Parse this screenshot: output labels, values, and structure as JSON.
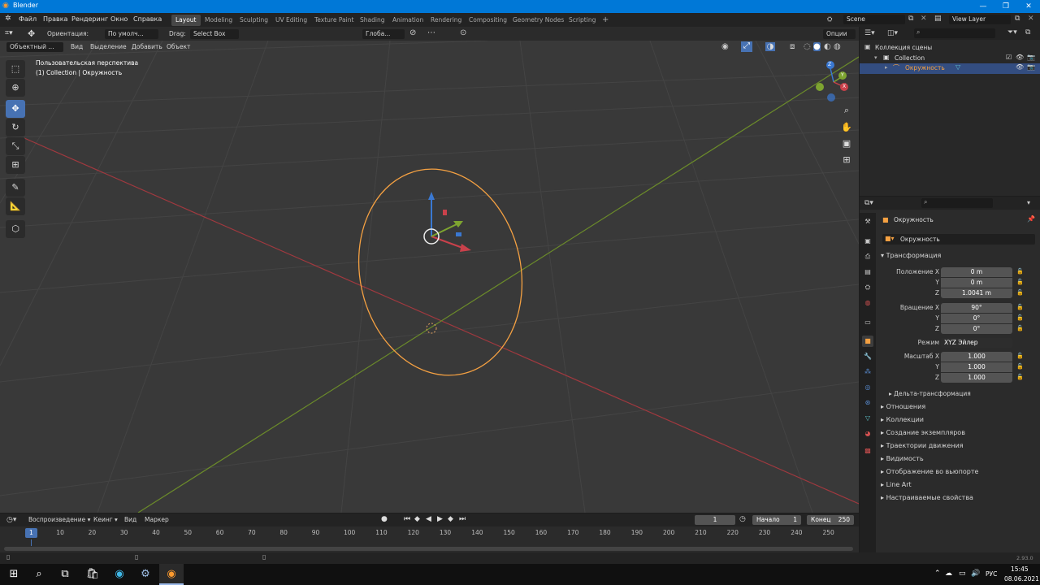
{
  "window": {
    "title": "Blender",
    "minimize": "—",
    "maximize": "❐",
    "close": "✕"
  },
  "menubar": {
    "items": [
      "Файл",
      "Правка",
      "Рендеринг",
      "Окно",
      "Справка"
    ],
    "workspaces": [
      "Layout",
      "Modeling",
      "Sculpting",
      "UV Editing",
      "Texture Paint",
      "Shading",
      "Animation",
      "Rendering",
      "Compositing",
      "Geometry Nodes",
      "Scripting"
    ],
    "active_workspace": "Layout",
    "add_tab": "+",
    "scene": "Scene",
    "view_layer": "View Layer"
  },
  "viewport_header": {
    "orientation_label": "Ориентация:",
    "orientation_value": "По умолч...",
    "drag_label": "Drag:",
    "drag_value": "Select Box",
    "pivot_value": "Глоба...",
    "options": "Опции",
    "mode": "Объектный ...",
    "menus": [
      "Вид",
      "Выделение",
      "Добавить",
      "Объект"
    ]
  },
  "viewport": {
    "view_name": "Пользовательская перспектива",
    "collection_info": "(1) Collection | Окружность",
    "gizmo_axes": [
      "Z",
      "Y",
      "X"
    ]
  },
  "outliner": {
    "scene_collection": "Коллекция сцены",
    "collection": "Collection",
    "object": "Окружность"
  },
  "properties": {
    "object_name": "Окружность",
    "data_name": "Окружность",
    "transform_title": "Трансформация",
    "location": {
      "label_x": "Положение X",
      "label_y": "Y",
      "label_z": "Z",
      "x": "0 m",
      "y": "0 m",
      "z": "1.0041 m"
    },
    "rotation": {
      "label_x": "Вращение X",
      "label_y": "Y",
      "label_z": "Z",
      "x": "90°",
      "y": "0°",
      "z": "0°"
    },
    "mode": {
      "label": "Режим",
      "value": "XYZ Эйлер"
    },
    "scale": {
      "label_x": "Масштаб X",
      "label_y": "Y",
      "label_z": "Z",
      "x": "1.000",
      "y": "1.000",
      "z": "1.000"
    },
    "delta": "Дельта-трансформация",
    "sections": [
      "Отношения",
      "Коллекции",
      "Создание экземпляров",
      "Траектории движения",
      "Видимость",
      "Отображение во вьюпорте",
      "Line Art",
      "Настраиваемые свойства"
    ]
  },
  "timeline": {
    "playback": "Воспроизведение",
    "keying": "Кеинг",
    "view": "Вид",
    "marker": "Маркер",
    "current_frame": "1",
    "start_label": "Начало",
    "start": "1",
    "end_label": "Конец",
    "end": "250",
    "ticks": [
      "1",
      "10",
      "20",
      "30",
      "40",
      "50",
      "60",
      "70",
      "80",
      "90",
      "100",
      "110",
      "120",
      "130",
      "140",
      "150",
      "160",
      "170",
      "180",
      "190",
      "200",
      "210",
      "220",
      "230",
      "240",
      "250"
    ]
  },
  "status": {
    "version": "2.93.0"
  },
  "taskbar": {
    "lang": "РУС",
    "time": "15:45",
    "date": "08.06.2021"
  },
  "colors": {
    "accent": "#4772b3",
    "selection_orange": "#f5a142",
    "x_axis": "#c9414b",
    "y_axis": "#7ea430",
    "z_axis": "#3a78d1"
  }
}
